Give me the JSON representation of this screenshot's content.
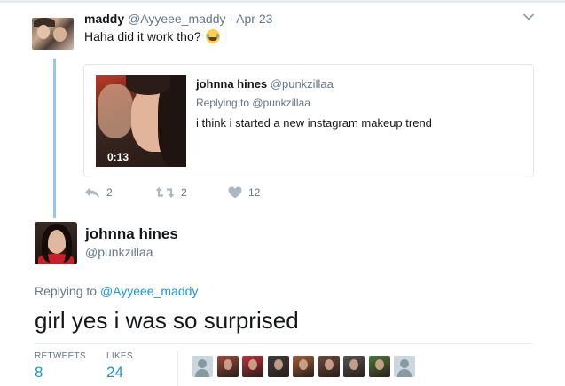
{
  "parent_tweet": {
    "author_name": "maddy",
    "author_handle": "@Ayyeee_maddy",
    "separator": "·",
    "date": "Apr 23",
    "text": "Haha did it work tho?",
    "emoji": "face-with-tears-of-joy",
    "quoted": {
      "author_name": "johnna hines",
      "author_handle": "@punkzillaa",
      "replying_to": "Replying to @punkzillaa",
      "text": "i think i started a new instagram makeup trend",
      "video_duration": "0:13"
    },
    "actions": {
      "replies": "2",
      "retweets": "2",
      "likes": "12"
    }
  },
  "main_tweet": {
    "author_name": "johnna hines",
    "author_handle": "@punkzillaa",
    "replying_prefix": "Replying to",
    "replying_to": "@Ayyeee_maddy",
    "text": "girl yes i was so surprised",
    "stats": {
      "retweets_label": "RETWEETS",
      "retweets_value": "8",
      "likes_label": "LIKES",
      "likes_value": "24"
    },
    "liker_avatars": [
      "default",
      "#9b4a3c",
      "#c0303a",
      "#3c3c3c",
      "#a0603c",
      "#6e4a3a",
      "#555555",
      "#4a7a3a",
      "default"
    ]
  },
  "colors": {
    "link": "#1b95e0",
    "secondary_text": "#657786",
    "thread_line": "#97c7e8",
    "border": "#e1e8ed"
  }
}
